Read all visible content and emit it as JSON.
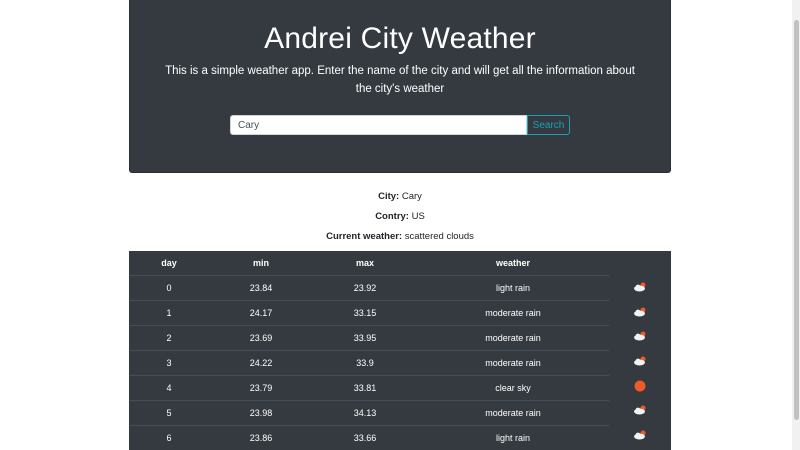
{
  "header": {
    "title": "Andrei City Weather",
    "description": "This is a simple weather app. Enter the name of the city and will get all the information about the city's weather"
  },
  "search": {
    "value": "Cary",
    "placeholder": "",
    "button_label": "Search"
  },
  "info": {
    "city_label": "City:",
    "city_value": "Cary",
    "country_label": "Contry:",
    "country_value": "US",
    "current_label": "Current weather:",
    "current_value": "scattered clouds"
  },
  "forecast": {
    "columns": [
      "day",
      "min",
      "max",
      "weather"
    ],
    "rows": [
      {
        "day": "0",
        "min": "23.84",
        "max": "23.92",
        "weather": "light rain",
        "icon": "cloud-sun-icon"
      },
      {
        "day": "1",
        "min": "24.17",
        "max": "33.15",
        "weather": "moderate rain",
        "icon": "cloud-sun-icon"
      },
      {
        "day": "2",
        "min": "23.69",
        "max": "33.95",
        "weather": "moderate rain",
        "icon": "cloud-sun-icon"
      },
      {
        "day": "3",
        "min": "24.22",
        "max": "33.9",
        "weather": "moderate rain",
        "icon": "cloud-sun-icon"
      },
      {
        "day": "4",
        "min": "23.79",
        "max": "33.81",
        "weather": "clear sky",
        "icon": "sun-icon"
      },
      {
        "day": "5",
        "min": "23.98",
        "max": "34.13",
        "weather": "moderate rain",
        "icon": "cloud-sun-icon"
      },
      {
        "day": "6",
        "min": "23.86",
        "max": "33.66",
        "weather": "light rain",
        "icon": "cloud-sun-icon"
      }
    ]
  },
  "colors": {
    "header_bg": "#343a40",
    "table_bg": "#343a40",
    "search_accent": "#17a2b8",
    "sun": "#f05a28"
  }
}
